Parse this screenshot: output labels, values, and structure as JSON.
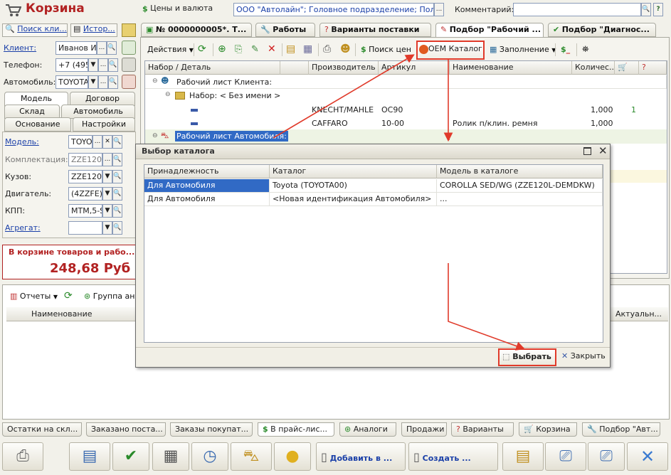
{
  "app": {
    "title": "Корзина",
    "prices_label": "Цены и валюта",
    "org_value": "ООО \"Автолайн\"; Головное подразделение; Пользова",
    "comment_label": "Комментарий:",
    "comment_value": ""
  },
  "left": {
    "search_client": "Поиск кли...",
    "history": "Истор...",
    "client_label": "Клиент:",
    "client_value": "Иванов Ив",
    "phone_label": "Телефон:",
    "phone_value": "+7 (495)",
    "car_label": "Автомобиль:",
    "car_value": "TOYOTA",
    "tabs_row1": [
      "Модель",
      "Договор"
    ],
    "tabs_row2": [
      "Склад",
      "Автомобиль"
    ],
    "tabs_row3": [
      "Основание",
      "Настройки"
    ],
    "model_label": "Модель:",
    "model_value": "TOYO",
    "complect_label": "Комплектация:",
    "complect_value": "ZZE120L",
    "body_label": "Кузов:",
    "body_value": "ZZE120L",
    "engine_label": "Двигатель:",
    "engine_value": "(4ZZFE)",
    "kpp_label": "КПП:",
    "kpp_value": "MTM,5-S",
    "aggr_label": "Агрегат:",
    "aggr_value": "",
    "basket_title": "В корзине товаров и рабо... -",
    "basket_sum": "248,68 Руб"
  },
  "top_tabs": [
    "№ 0000000005*. Т...",
    "Работы",
    "Варианты поставки",
    "Подбор \"Рабочий ...",
    "Подбор \"Диагнос..."
  ],
  "toolbar": {
    "actions": "Действия",
    "price_search": "Поиск цен",
    "oem": "OEM Каталог",
    "fill": "Заполнение"
  },
  "main_grid": {
    "headers": [
      "Набор / Деталь",
      "",
      "Производитель",
      "Артикул",
      "Наименование",
      "Количес...",
      "",
      ""
    ],
    "rows": [
      {
        "c0": "Рабочий лист Клиента:"
      },
      {
        "c0": "Набор: < Без имени >"
      },
      {
        "c0": "",
        "maker": "KNECHT/MAHLE",
        "art": "OC90",
        "name": "",
        "qty": "1,000",
        "x": "1"
      },
      {
        "c0": "",
        "maker": "CAFFARO",
        "art": "10-00",
        "name": "Ролик п/клин. ремня",
        "qty": "1,000",
        "x": ""
      },
      {
        "c0": "Рабочий лист Автомобиля:"
      }
    ]
  },
  "lower": {
    "reports": "Отчеты",
    "group": "Группа ана",
    "col_name": "Наименование",
    "col_actual": "Актуальн..."
  },
  "dialog": {
    "title": "Выбор каталога",
    "headers": [
      "Принадлежность",
      "Каталог",
      "Модель в каталоге"
    ],
    "rows": [
      [
        "Для Автомобиля",
        "Toyota (TOYOTA00)",
        "COROLLA SED/WG (ZZE120L-DEMDKW)"
      ],
      [
        "Для Автомобиля",
        "<Новая идентификация Автомобиля>",
        "..."
      ]
    ],
    "select": "Выбрать",
    "close": "Закрыть"
  },
  "bottom_tabs": [
    "Остатки на скл...",
    "Заказано поста...",
    "Заказы покупат...",
    "В прайс-лис...",
    "Аналоги",
    "Продажи",
    "Варианты",
    "Корзина",
    "Подбор \"Авт..."
  ],
  "footer": {
    "add": "Добавить в ...",
    "create": "Создать ..."
  },
  "colors": {
    "accent_red": "#e03a2a",
    "title_red": "#b22222",
    "selection_blue": "#316ac5"
  }
}
